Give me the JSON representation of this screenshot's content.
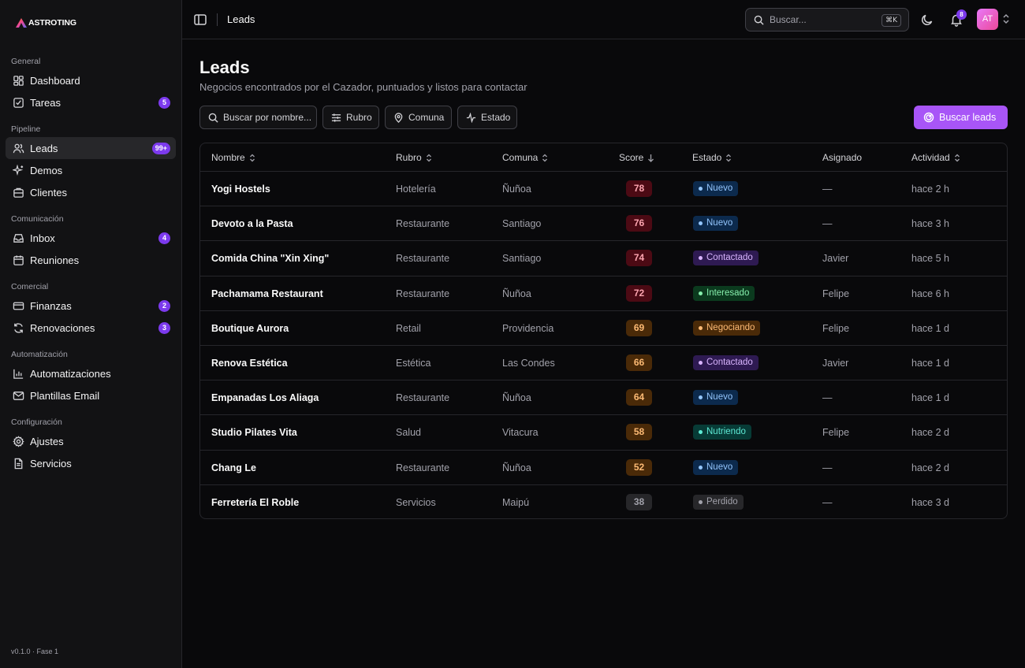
{
  "brand": {
    "name": "ASTROTING"
  },
  "sidebar": {
    "sections": [
      {
        "label": "General",
        "items": [
          {
            "label": "Dashboard",
            "icon": "dashboard-icon"
          },
          {
            "label": "Tareas",
            "icon": "tasks-icon",
            "badge": "5"
          }
        ]
      },
      {
        "label": "Pipeline",
        "items": [
          {
            "label": "Leads",
            "icon": "users-icon",
            "badge": "99+",
            "active": true
          },
          {
            "label": "Demos",
            "icon": "sparkles-icon"
          },
          {
            "label": "Clientes",
            "icon": "building-icon"
          }
        ]
      },
      {
        "label": "Comunicación",
        "items": [
          {
            "label": "Inbox",
            "icon": "inbox-icon",
            "badge": "4"
          },
          {
            "label": "Reuniones",
            "icon": "calendar-icon"
          }
        ]
      },
      {
        "label": "Comercial",
        "items": [
          {
            "label": "Finanzas",
            "icon": "credit-card-icon",
            "badge": "2"
          },
          {
            "label": "Renovaciones",
            "icon": "refresh-icon",
            "badge": "3"
          }
        ]
      },
      {
        "label": "Automatización",
        "items": [
          {
            "label": "Automatizaciones",
            "icon": "bar-chart-icon"
          },
          {
            "label": "Plantillas Email",
            "icon": "mail-icon"
          }
        ]
      },
      {
        "label": "Configuración",
        "items": [
          {
            "label": "Ajustes",
            "icon": "gear-icon"
          },
          {
            "label": "Servicios",
            "icon": "document-icon"
          }
        ]
      }
    ],
    "version": "v0.1.0 · Fase 1"
  },
  "topbar": {
    "breadcrumb": "Leads",
    "search_placeholder": "Buscar...",
    "search_shortcut": "⌘K",
    "notifications_count": "8",
    "avatar_initials": "AT"
  },
  "page": {
    "title": "Leads",
    "subtitle": "Negocios encontrados por el Cazador, puntuados y listos para contactar"
  },
  "filters": {
    "search_placeholder": "Buscar por nombre...",
    "rubro": "Rubro",
    "comuna": "Comuna",
    "estado": "Estado",
    "primary_action": "Buscar leads"
  },
  "table": {
    "columns": [
      "Nombre",
      "Rubro",
      "Comuna",
      "Score",
      "Estado",
      "Asignado",
      "Actividad"
    ],
    "rows": [
      {
        "nombre": "Yogi Hostels",
        "rubro": "Hotelería",
        "comuna": "Ñuñoa",
        "score": "78",
        "estado": "Nuevo",
        "asignado": "—",
        "actividad": "hace 2 h"
      },
      {
        "nombre": "Devoto a la Pasta",
        "rubro": "Restaurante",
        "comuna": "Santiago",
        "score": "76",
        "estado": "Nuevo",
        "asignado": "—",
        "actividad": "hace 3 h"
      },
      {
        "nombre": "Comida China \"Xin Xing\"",
        "rubro": "Restaurante",
        "comuna": "Santiago",
        "score": "74",
        "estado": "Contactado",
        "asignado": "Javier",
        "actividad": "hace 5 h"
      },
      {
        "nombre": "Pachamama Restaurant",
        "rubro": "Restaurante",
        "comuna": "Ñuñoa",
        "score": "72",
        "estado": "Interesado",
        "asignado": "Felipe",
        "actividad": "hace 6 h"
      },
      {
        "nombre": "Boutique Aurora",
        "rubro": "Retail",
        "comuna": "Providencia",
        "score": "69",
        "estado": "Negociando",
        "asignado": "Felipe",
        "actividad": "hace 1 d"
      },
      {
        "nombre": "Renova Estética",
        "rubro": "Estética",
        "comuna": "Las Condes",
        "score": "66",
        "estado": "Contactado",
        "asignado": "Javier",
        "actividad": "hace 1 d"
      },
      {
        "nombre": "Empanadas Los Aliaga",
        "rubro": "Restaurante",
        "comuna": "Ñuñoa",
        "score": "64",
        "estado": "Nuevo",
        "asignado": "—",
        "actividad": "hace 1 d"
      },
      {
        "nombre": "Studio Pilates Vita",
        "rubro": "Salud",
        "comuna": "Vitacura",
        "score": "58",
        "estado": "Nutriendo",
        "asignado": "Felipe",
        "actividad": "hace 2 d"
      },
      {
        "nombre": "Chang Le",
        "rubro": "Restaurante",
        "comuna": "Ñuñoa",
        "score": "52",
        "estado": "Nuevo",
        "asignado": "—",
        "actividad": "hace 2 d"
      },
      {
        "nombre": "Ferretería El Roble",
        "rubro": "Servicios",
        "comuna": "Maipú",
        "score": "38",
        "estado": "Perdido",
        "asignado": "—",
        "actividad": "hace 3 d"
      }
    ]
  },
  "colors": {
    "accent": "#a855f7",
    "badge": "#7c3aed",
    "score_high": {
      "bg": "#4c0a14",
      "fg": "#fda4af"
    },
    "score_mid": {
      "bg": "#4a2a08",
      "fg": "#fdba74"
    },
    "score_low": {
      "bg": "#27272a",
      "fg": "#a1a1aa"
    },
    "status": {
      "Nuevo": {
        "bg": "#0c2a4d",
        "fg": "#93c5fd",
        "dot": "#60a5fa"
      },
      "Contactado": {
        "bg": "#2e1a52",
        "fg": "#d8b4fe",
        "dot": "#c084fc"
      },
      "Interesado": {
        "bg": "#0b3a1e",
        "fg": "#86efac",
        "dot": "#4ade80"
      },
      "Negociando": {
        "bg": "#4a2a08",
        "fg": "#fdba74",
        "dot": "#fb923c"
      },
      "Nutriendo": {
        "bg": "#073b36",
        "fg": "#5eead4",
        "dot": "#2dd4bf"
      },
      "Perdido": {
        "bg": "#27272a",
        "fg": "#a1a1aa",
        "dot": "#a1a1aa"
      }
    }
  }
}
